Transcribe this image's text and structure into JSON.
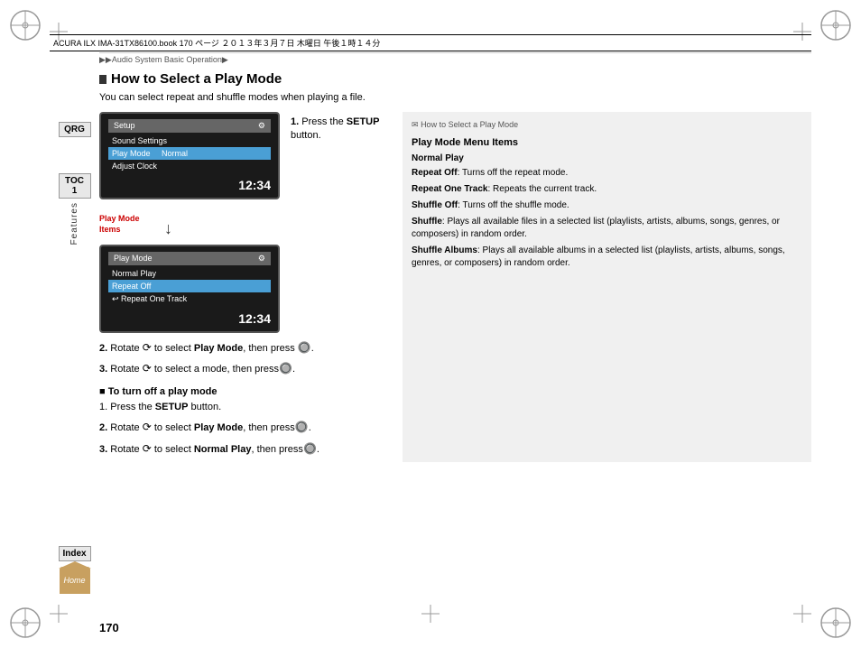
{
  "page": {
    "number": "170",
    "header_text": "▶▶Audio System Basic Operation▶"
  },
  "file_info": {
    "text": "ACURA ILX IMA-31TX86100.book  170 ページ  ２０１３年３月７日  木曜日  午後１時１４分"
  },
  "sidebar": {
    "qrg_label": "QRG",
    "toc_label": "TOC 1",
    "features_label": "Features",
    "index_label": "Index",
    "home_label": "Home"
  },
  "section": {
    "title": "How to Select a Play Mode",
    "subtitle": "You can select repeat and shuffle modes when playing a file.",
    "step1": "Press the ",
    "step1_bold": "SETUP",
    "step1_end": " button.",
    "step2_prefix": "2. Rotate ",
    "step2_bold": "Play Mode",
    "step2_end": ", then press",
    "step3_prefix": "3. Rotate ",
    "step3_end": " to select a mode, then press",
    "turn_off_title": "■ To turn off a play mode",
    "turn_off_step1": "1. Press the ",
    "turn_off_step1_bold": "SETUP",
    "turn_off_step1_end": " button.",
    "turn_off_step2_prefix": "2. Rotate ",
    "turn_off_step2_bold": "Play Mode",
    "turn_off_step2_end": ", then press",
    "turn_off_step3_prefix": "3. Rotate ",
    "turn_off_step3_bold": "Normal Play",
    "turn_off_step3_end": ", then press"
  },
  "screen1": {
    "title": "Setup",
    "menu_items": [
      "Sound Settings",
      "Play Mode    Normal",
      "Adjust Clock"
    ],
    "selected_index": 1,
    "time": "12:34"
  },
  "screen2": {
    "title": "Play Mode",
    "menu_items": [
      "Normal Play",
      "Repeat Off",
      "↩ Repeat One Track"
    ],
    "selected_index": 1,
    "time": "12:34"
  },
  "annotation": {
    "label": "Play Mode\nItems"
  },
  "right_panel": {
    "breadcrumb": "✉How to Select a Play Mode",
    "heading1": "Play Mode Menu Items",
    "heading2": "Normal Play",
    "item1_bold": "Repeat Off",
    "item1_text": ": Turns off the repeat mode.",
    "item2_bold": "Repeat One Track",
    "item2_text": ": Repeats the current track.",
    "item3_bold": "Shuffle Off",
    "item3_text": ": Turns off the shuffle mode.",
    "item4_bold": "Shuffle",
    "item4_text": ": Plays all available files in a selected list (playlists, artists, albums, songs, genres, or composers) in random order.",
    "item5_bold": "Shuffle Albums",
    "item5_text": ": Plays all available albums in a selected list (playlists, artists, albums, songs, genres, or composers) in random order."
  }
}
